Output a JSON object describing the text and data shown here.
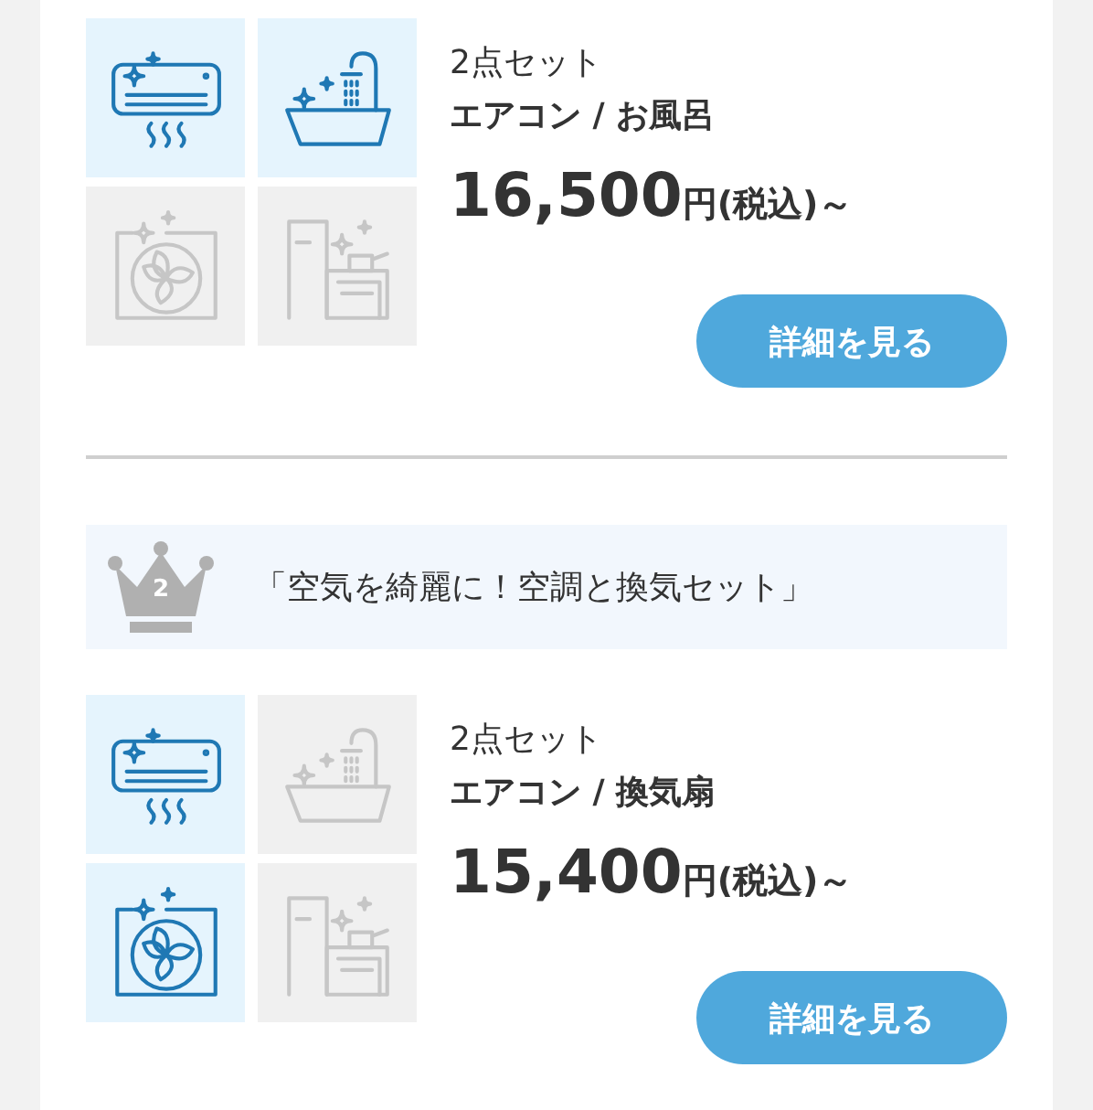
{
  "sets": [
    {
      "tiles": [
        {
          "kind": "aircon",
          "included": true
        },
        {
          "kind": "bath",
          "included": true
        },
        {
          "kind": "fan",
          "included": false
        },
        {
          "kind": "kitchen",
          "included": false
        }
      ],
      "count": "2点セット",
      "title": "エアコン / お風呂",
      "price": "16,500",
      "price_suffix": "円(税込)～",
      "button": "詳細を見る"
    },
    {
      "banner": {
        "rank": "2",
        "text": "「空気を綺麗に！空調と換気セット」"
      },
      "tiles": [
        {
          "kind": "aircon",
          "included": true
        },
        {
          "kind": "bath",
          "included": false
        },
        {
          "kind": "fan",
          "included": true
        },
        {
          "kind": "kitchen",
          "included": false
        }
      ],
      "count": "2点セット",
      "title": "エアコン / 換気扇",
      "price": "15,400",
      "price_suffix": "円(税込)～",
      "button": "詳細を見る"
    }
  ]
}
